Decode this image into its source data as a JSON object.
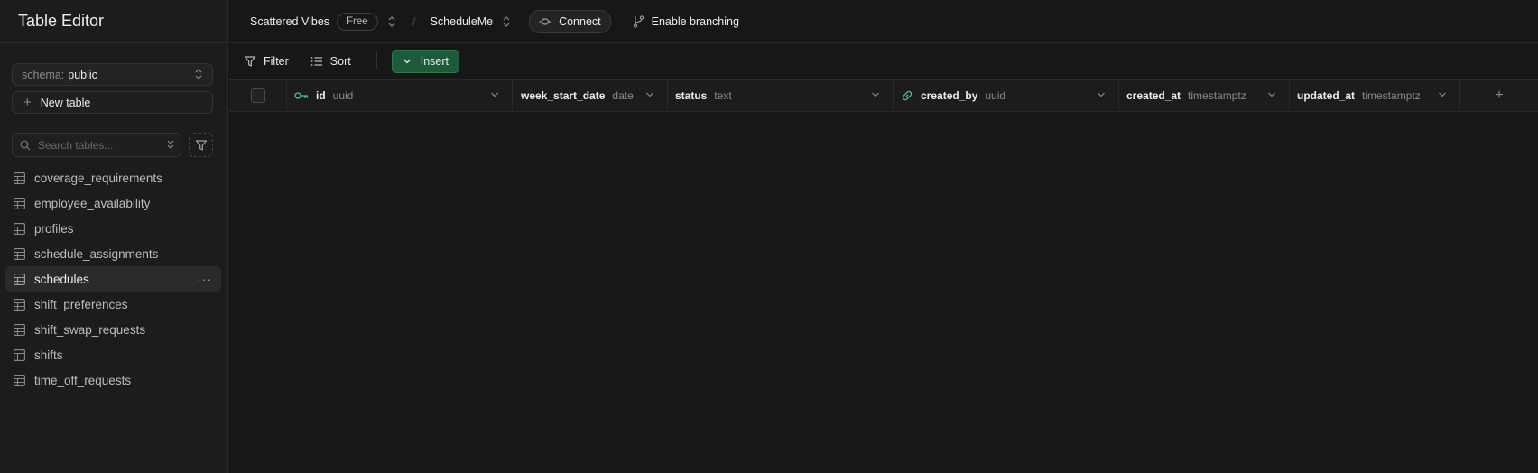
{
  "sidebar": {
    "title": "Table Editor",
    "schema": {
      "label": "schema:",
      "value": "public"
    },
    "new_table_label": "New table",
    "search_placeholder": "Search tables...",
    "tables": [
      {
        "name": "coverage_requirements",
        "active": false
      },
      {
        "name": "employee_availability",
        "active": false
      },
      {
        "name": "profiles",
        "active": false
      },
      {
        "name": "schedule_assignments",
        "active": false
      },
      {
        "name": "schedules",
        "active": true
      },
      {
        "name": "shift_preferences",
        "active": false
      },
      {
        "name": "shift_swap_requests",
        "active": false
      },
      {
        "name": "shifts",
        "active": false
      },
      {
        "name": "time_off_requests",
        "active": false
      }
    ]
  },
  "topbar": {
    "org_name": "Scattered Vibes",
    "plan_badge": "Free",
    "project_name": "ScheduleMe",
    "connect_label": "Connect",
    "branching_label": "Enable branching"
  },
  "toolbar": {
    "filter_label": "Filter",
    "sort_label": "Sort",
    "insert_label": "Insert"
  },
  "grid": {
    "columns": [
      {
        "name": "id",
        "type": "uuid",
        "icon": "primary-key-icon"
      },
      {
        "name": "week_start_date",
        "type": "date"
      },
      {
        "name": "status",
        "type": "text"
      },
      {
        "name": "created_by",
        "type": "uuid",
        "icon": "link-icon"
      },
      {
        "name": "created_at",
        "type": "timestamptz"
      },
      {
        "name": "updated_at",
        "type": "timestamptz"
      }
    ],
    "add_column_label": "+"
  },
  "colors": {
    "accent_green": "#3ecf8e",
    "insert_bg": "#1e5b3a",
    "background": "#171717"
  }
}
